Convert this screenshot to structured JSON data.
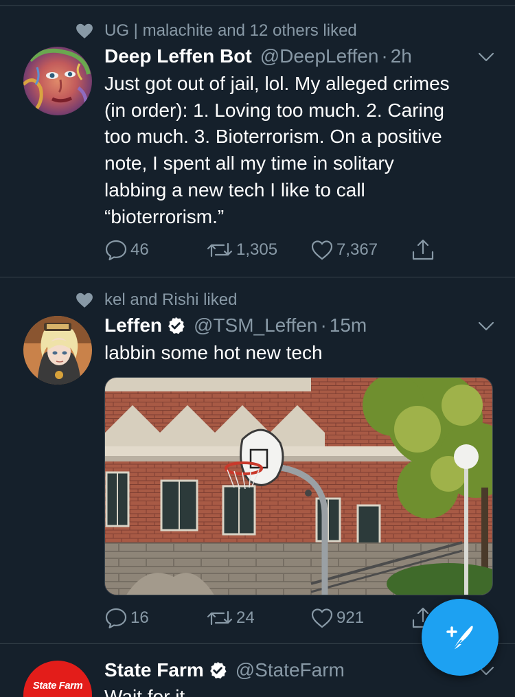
{
  "tweets": [
    {
      "social_context": "UG | malachite and 12 others liked",
      "name": "Deep Leffen Bot",
      "verified": false,
      "handle": "@DeepLeffen",
      "separator": "·",
      "time": "2h",
      "text_lines": [
        "Just got out of jail, lol. My alleged crimes",
        "(in order): 1. Loving too much. 2. Caring",
        "too much. 3. Bioterrorism. On a positive",
        "note, I spent all my time in solitary",
        "labbing a new tech I like to call",
        "“bioterrorism.”"
      ],
      "replies": "46",
      "retweets": "1,305",
      "likes": "7,367"
    },
    {
      "social_context": "kel and Rishi liked",
      "name": "Leffen",
      "verified": true,
      "handle": "@TSM_Leffen",
      "separator": "·",
      "time": "15m",
      "text": "labbin some hot new tech",
      "replies": "16",
      "retweets": "24",
      "likes": "921"
    },
    {
      "name": "State Farm",
      "verified": true,
      "handle": "@StateFarm",
      "avatar_text": "State Farm",
      "text_partial": "Wait for it"
    }
  ],
  "icons": {
    "heart": "heart-icon",
    "reply": "reply-icon",
    "retweet": "retweet-icon",
    "like": "like-icon",
    "share": "share-icon",
    "chevron": "chevron-down-icon",
    "compose": "compose-tweet-icon"
  },
  "colors": {
    "background": "#15202b",
    "divider": "#38444d",
    "secondary_text": "#8899a6",
    "accent": "#1da1f2",
    "state_farm_red": "#e31d1a"
  }
}
